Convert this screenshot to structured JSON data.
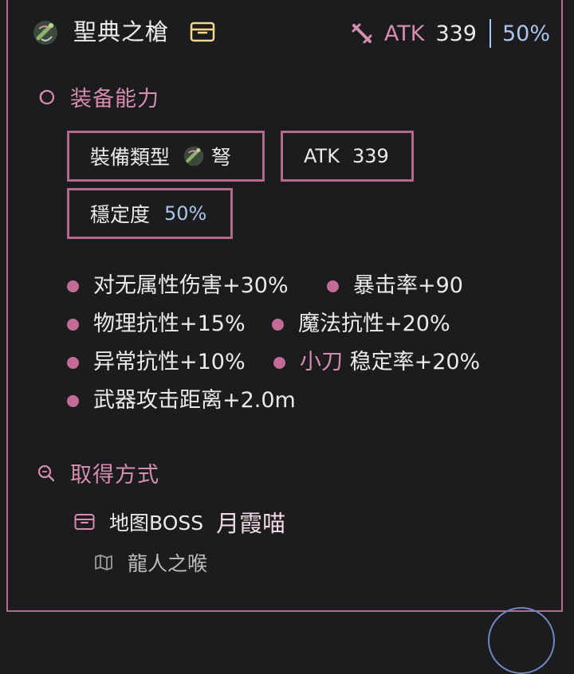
{
  "header": {
    "item_name": "聖典之槍",
    "atk_label": "ATK",
    "atk_value": "339",
    "stability_value": "50%"
  },
  "ability_section": {
    "title": "装备能力",
    "equip_type_label": "裝備類型",
    "equip_type_value": "弩",
    "atk_label": "ATK",
    "atk_value": "339",
    "stability_label": "穩定度",
    "stability_value": "50%"
  },
  "bonuses": [
    {
      "text": "对无属性伤害+30%"
    },
    {
      "text": "暴击率+90"
    },
    {
      "text": "物理抗性+15%"
    },
    {
      "text": "魔法抗性+20%"
    },
    {
      "text": "异常抗性+10%"
    },
    {
      "prefix": "小刀",
      "text": " 稳定率+20%"
    },
    {
      "text": "武器攻击距离+2.0m"
    }
  ],
  "acquire_section": {
    "title": "取得方式",
    "source_type": "地图BOSS",
    "source_name": "月霞喵",
    "location": "龍人之喉"
  },
  "colors": {
    "accent_pink": "#d58db0",
    "border_pink": "#b56a8c",
    "stability_blue": "#a9c6ec",
    "background": "#1c1b1d"
  },
  "icons": {
    "weapon": "crossbow-icon",
    "box": "item-box-icon",
    "atk": "sword-icon",
    "ability": "ring-icon",
    "search": "search-icon",
    "source": "item-box-icon",
    "map": "map-icon"
  }
}
